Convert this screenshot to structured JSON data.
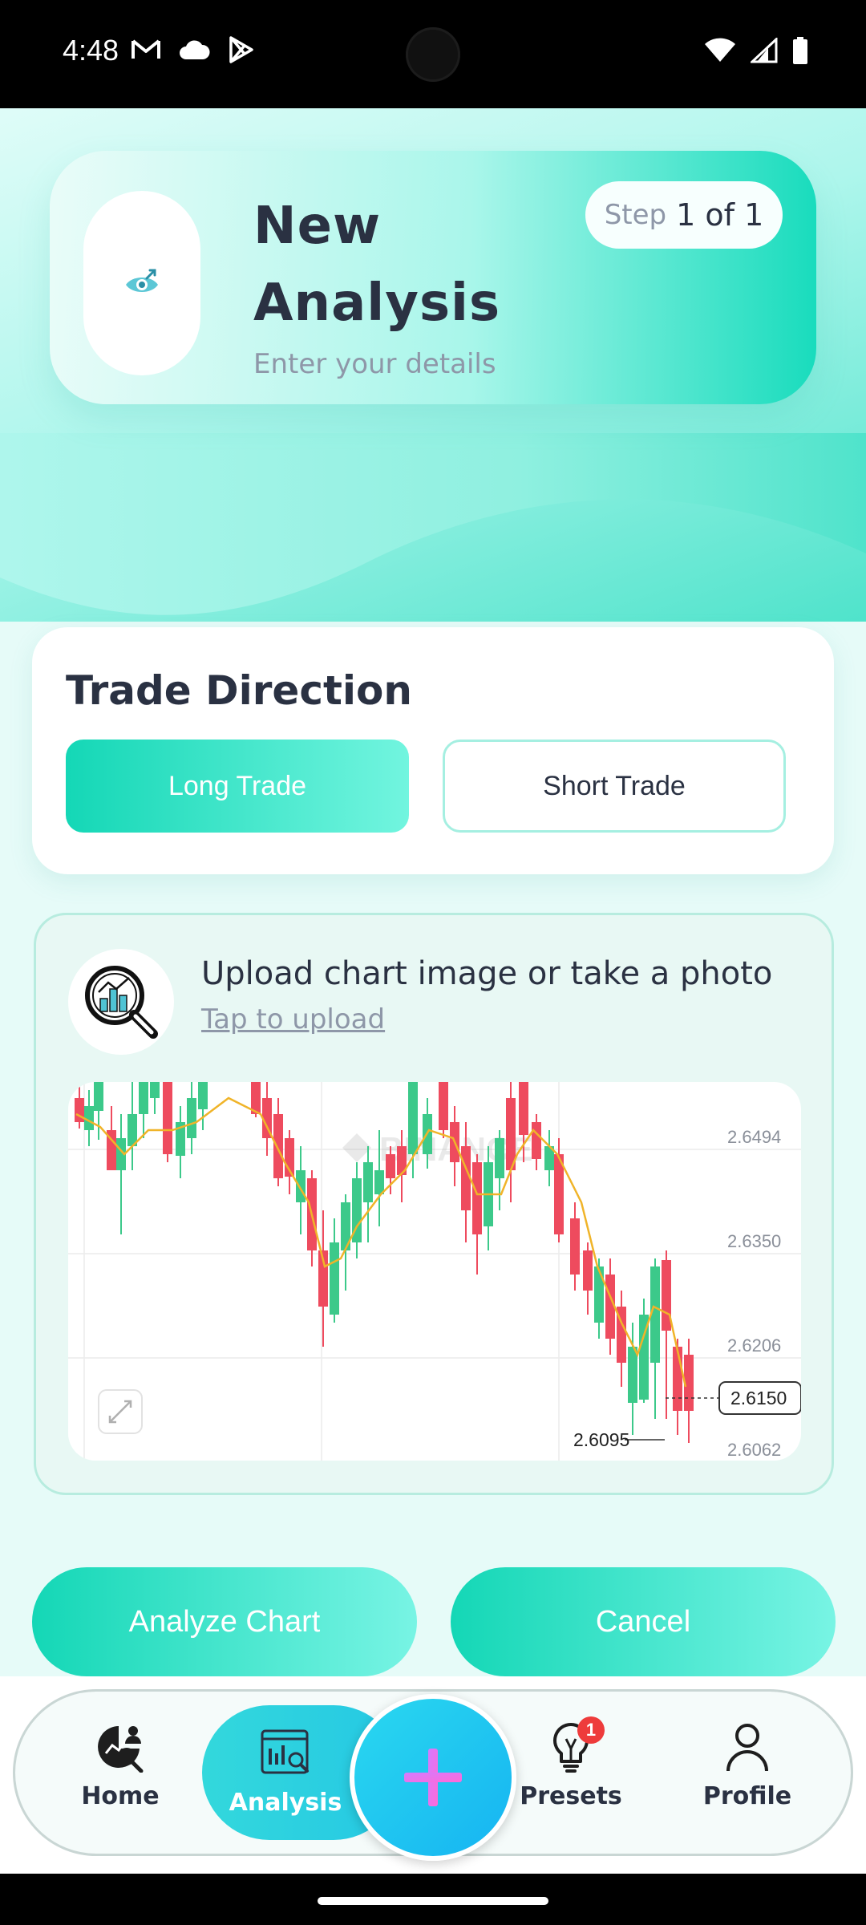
{
  "status_bar": {
    "time": "4:48",
    "left_icons": [
      "gmail-icon",
      "cloud-icon",
      "play-store-icon"
    ],
    "right_icons": [
      "wifi-icon",
      "signal-icon",
      "battery-icon"
    ]
  },
  "header": {
    "icon": "eye-analysis-icon",
    "title": "New Analysis",
    "subtitle": "Enter your details",
    "step_word": "Step",
    "step_count": "1 of 1"
  },
  "trade_direction": {
    "title": "Trade Direction",
    "options": [
      "Long Trade",
      "Short Trade"
    ],
    "selected": "Long Trade"
  },
  "upload": {
    "icon": "magnifier-chart-icon",
    "prompt": "Upload chart image or take a photo",
    "link": "Tap to upload",
    "preview": {
      "watermark": "BINANCE",
      "price_levels": [
        "2.6494",
        "2.6350",
        "2.6206",
        "2.6062"
      ],
      "current_price": "2.6150",
      "low_price": "2.6095",
      "expand_icon": "expand-icon"
    }
  },
  "actions": {
    "analyze_label": "Analyze Chart",
    "cancel_label": "Cancel"
  },
  "bottom_nav": {
    "items": [
      {
        "label": "Home",
        "icon": "home-analytics-icon"
      },
      {
        "label": "Analysis",
        "icon": "analysis-icon"
      },
      {
        "label": "Presets",
        "icon": "lightbulb-icon"
      },
      {
        "label": "Profile",
        "icon": "profile-icon"
      }
    ],
    "active": "Analysis",
    "fab_icon": "plus-icon",
    "presets_badge": "1"
  },
  "colors": {
    "accent": "#14d7b6",
    "text_dark": "#2a3142",
    "text_muted": "#8e97a8",
    "candle_up": "#3cc98a",
    "candle_down": "#ee4b5e",
    "ma_line": "#f0b429",
    "fab": "#16b4f2"
  }
}
